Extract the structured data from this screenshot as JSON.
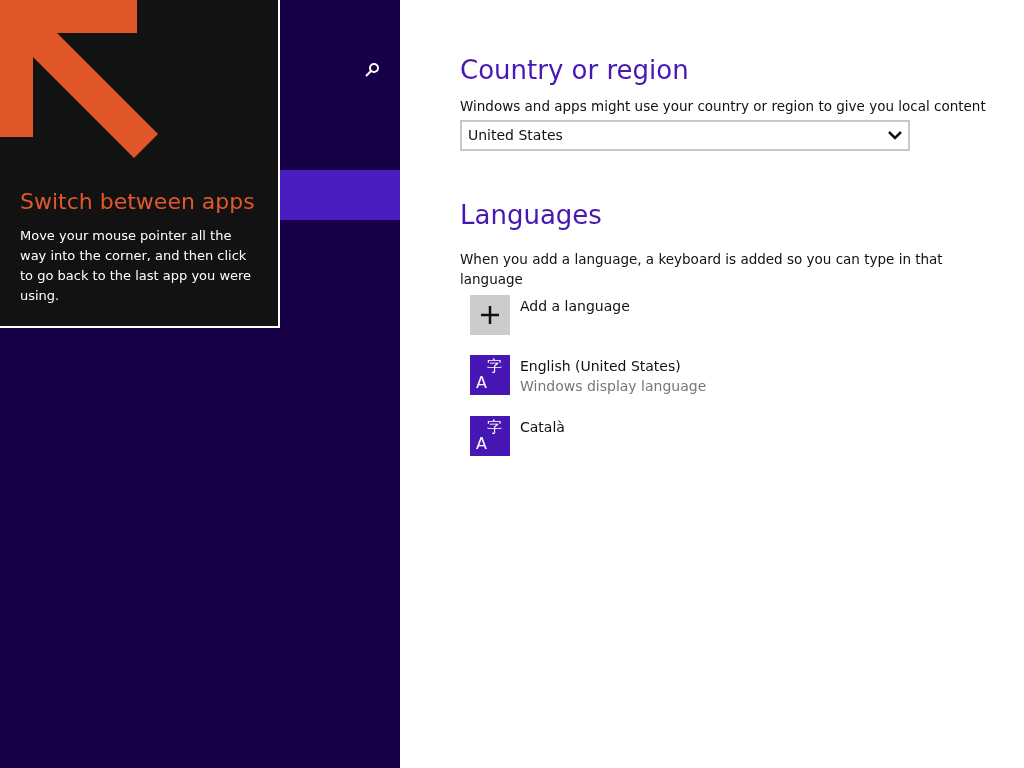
{
  "sidebar": {
    "items": [
      {
        "selected": true
      }
    ]
  },
  "tip": {
    "title": "Switch between apps",
    "body": "Move your mouse pointer all the way into the corner, and then click to go back to the last app you were using."
  },
  "country_section": {
    "title": "Country or region",
    "description": "Windows and apps might use your country or region to give you local content",
    "dropdown": {
      "value": "United States"
    }
  },
  "languages_section": {
    "title": "Languages",
    "description": "When you add a language, a keyboard is added so you can type in that language",
    "items": [
      {
        "kind": "add",
        "label": "Add a language"
      },
      {
        "kind": "language",
        "glyphs": [
          "A",
          "字"
        ],
        "label": "English (United States)",
        "sublabel": "Windows display language"
      },
      {
        "kind": "language",
        "glyphs": [
          "A",
          "字"
        ],
        "label": "Català"
      }
    ]
  }
}
